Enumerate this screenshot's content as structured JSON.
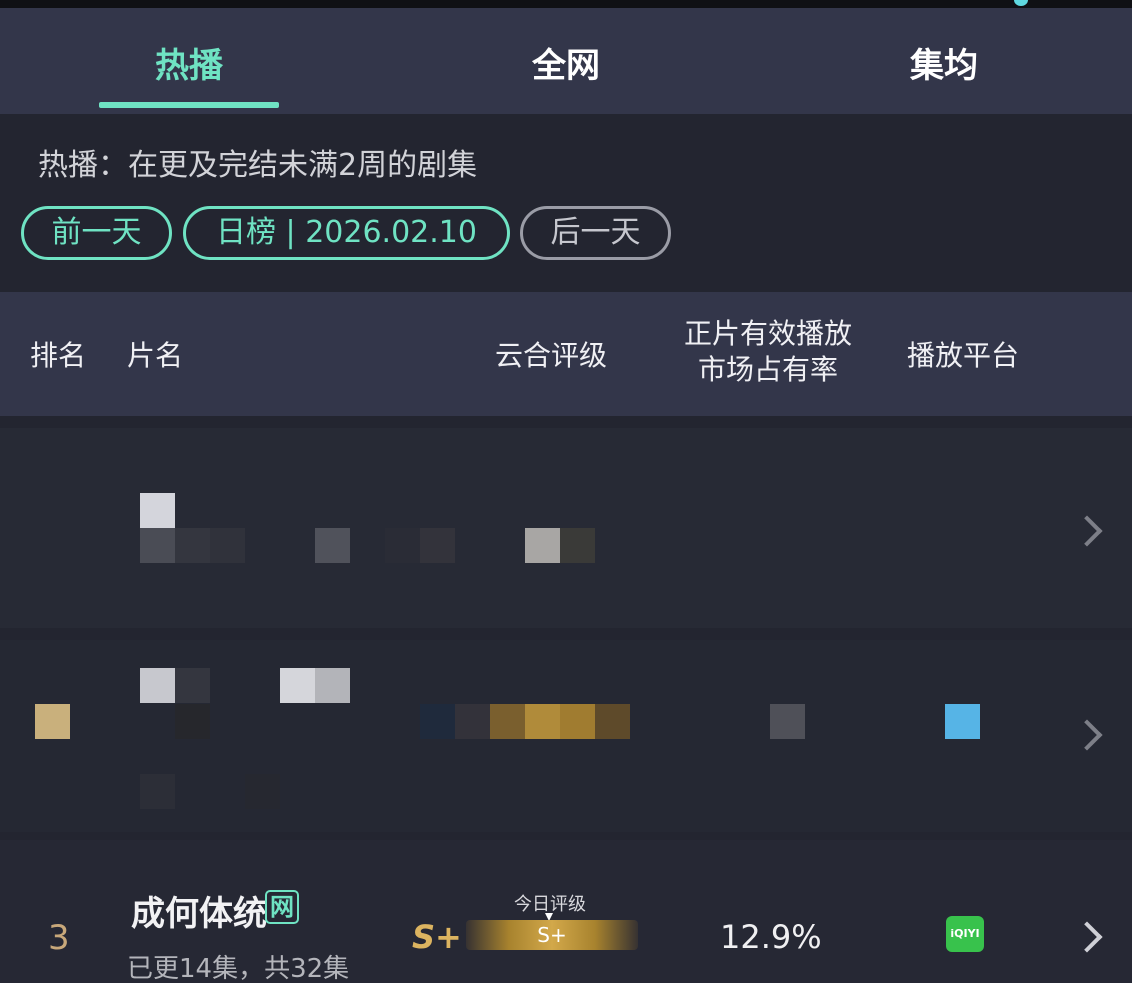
{
  "tabs": [
    {
      "label": "热播",
      "active": true
    },
    {
      "label": "全网",
      "active": false
    },
    {
      "label": "集均",
      "active": false
    }
  ],
  "info": {
    "description": "热播：在更及完结未满2周的剧集",
    "prev_day": "前一天",
    "date_label": "日榜 | 2026.02.10",
    "next_day": "后一天"
  },
  "table_header": {
    "rank": "排名",
    "title": "片名",
    "rating": "云合评级",
    "share_line1": "正片有效播放",
    "share_line2": "市场占有率",
    "platform": "播放平台"
  },
  "rows": [
    {
      "rank": "",
      "title": "",
      "episodes": "",
      "grade": "",
      "share": "",
      "platform": "",
      "obscured": true
    },
    {
      "rank": "",
      "title": "",
      "episodes": "",
      "grade": "",
      "share": "",
      "platform": "",
      "obscured": true
    },
    {
      "rank": "3",
      "title": "成何体统",
      "tag": "网",
      "episodes": "已更14集，共32集",
      "grade": "S+",
      "grade_today_label": "今日评级",
      "grade_today": "S+",
      "share": "12.9%",
      "platform": "iQIYI",
      "platform_icon": "iqiyi-logo-icon"
    }
  ],
  "colors": {
    "accent": "#6fe3c3",
    "header_bg": "#33364a",
    "page_bg": "#232530",
    "gold": "#dcb460",
    "iqiyi_green": "#38c24c"
  }
}
